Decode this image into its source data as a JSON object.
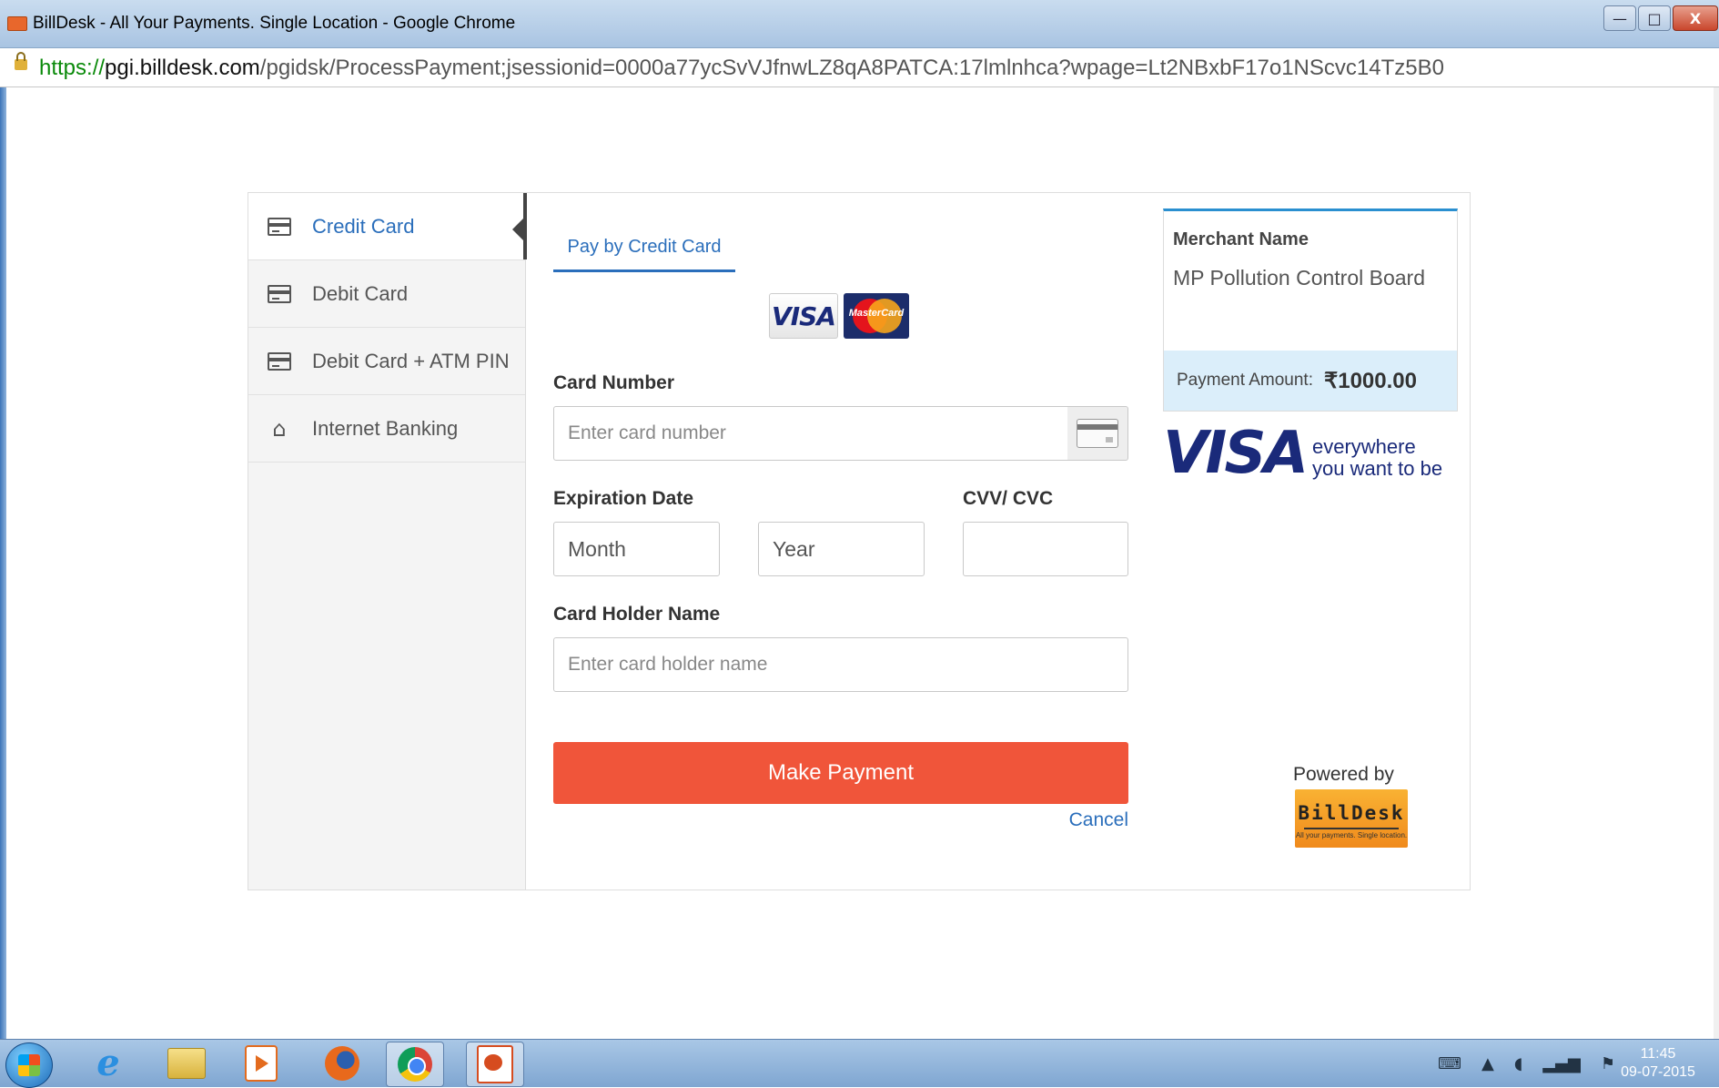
{
  "window": {
    "title": "BillDesk - All Your Payments. Single Location - Google Chrome",
    "controls": {
      "minimize": "—",
      "maximize": "□",
      "close": "X"
    }
  },
  "address": {
    "scheme": "https://",
    "host": "pgi.billdesk.com",
    "path": "/pgidsk/ProcessPayment;jsessionid=0000a77ycSvVJfnwLZ8qA8PATCA:17lmlnhca?wpage=Lt2NBxbF17o1NScvc14Tz5B0"
  },
  "sidebar": {
    "items": [
      {
        "label": "Credit Card",
        "icon": "credit-card-icon",
        "active": true
      },
      {
        "label": "Debit Card",
        "icon": "debit-card-icon",
        "active": false
      },
      {
        "label": "Debit Card + ATM PIN",
        "icon": "atm-card-icon",
        "active": false
      },
      {
        "label": "Internet Banking",
        "icon": "home-icon",
        "active": false
      }
    ]
  },
  "form": {
    "tab_label": "Pay by Credit Card",
    "accepted_cards": {
      "visa": "VISA",
      "mastercard": "MasterCard"
    },
    "card_number": {
      "label": "Card Number",
      "placeholder": "Enter card number",
      "value": ""
    },
    "expiration": {
      "label": "Expiration Date",
      "month": "Month",
      "year": "Year"
    },
    "cvv": {
      "label": "CVV/ CVC",
      "value": ""
    },
    "holder": {
      "label": "Card Holder Name",
      "placeholder": "Enter card holder name",
      "value": ""
    },
    "submit_label": "Make Payment",
    "cancel_label": "Cancel"
  },
  "merchant": {
    "name_label": "Merchant Name",
    "name": "MP Pollution Control Board",
    "amount_label": "Payment Amount:",
    "amount": "₹1000.00"
  },
  "promo": {
    "visa_word": "VISA",
    "tagline_1": "everywhere",
    "tagline_2": "you want to be"
  },
  "powered": {
    "label": "Powered by",
    "brand": "BillDesk",
    "brand_tagline": "All your payments. Single location."
  },
  "taskbar": {
    "apps": [
      "start",
      "internet-explorer",
      "file-explorer",
      "media-player",
      "firefox",
      "chrome",
      "presentation"
    ],
    "active_app": "chrome",
    "clock_time": "11:45",
    "clock_date": "09-07-2015"
  },
  "colors": {
    "accent_blue": "#2a6ebb",
    "pay_button": "#f0553a",
    "amount_strip": "#dbeefa",
    "visa_navy": "#1a2a7a"
  }
}
